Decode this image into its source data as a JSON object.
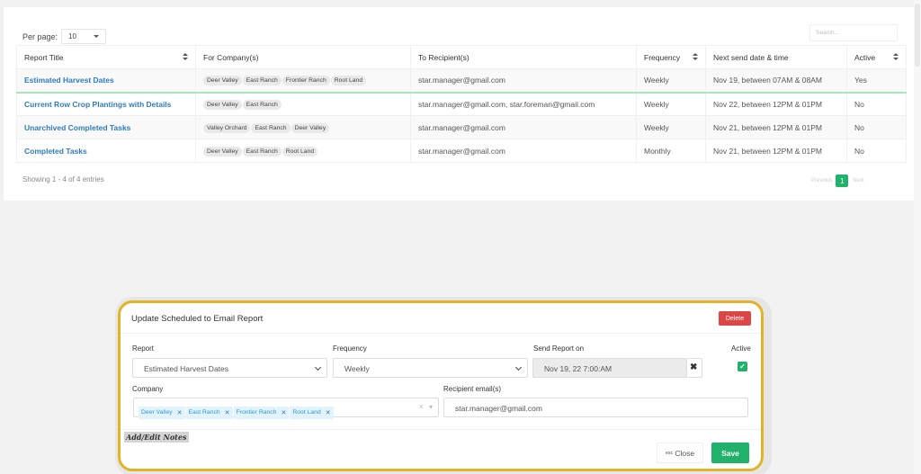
{
  "list": {
    "per_page_label": "Per page:",
    "per_page_value": "10",
    "search_placeholder": "Search...",
    "columns": [
      "Report Title",
      "For Company(s)",
      "To Recipient(s)",
      "Frequency",
      "Next send date & time",
      "Active"
    ],
    "rows": [
      {
        "title": "Estimated Harvest Dates",
        "companies": [
          "Deer Valley",
          "East Ranch",
          "Frontier Ranch",
          "Root Land"
        ],
        "recipients": "star.manager@gmail.com",
        "frequency": "Weekly",
        "next_send": "Nov 19, between 07AM & 08AM",
        "active": "Yes"
      },
      {
        "title": "Current Row Crop Plantings with Details",
        "companies": [
          "Deer Valley",
          "East Ranch"
        ],
        "recipients": "star.manager@gmail.com, star.foreman@gmail.com",
        "frequency": "Weekly",
        "next_send": "Nov 22, between 12PM & 01PM",
        "active": "No"
      },
      {
        "title": "Unarchived Completed Tasks",
        "companies": [
          "Valley Orchard",
          "East Ranch",
          "Deer Valley"
        ],
        "recipients": "star.manager@gmail.com",
        "frequency": "Weekly",
        "next_send": "Nov 21, between 12PM & 01PM",
        "active": "No"
      },
      {
        "title": "Completed Tasks",
        "companies": [
          "Deer Valley",
          "East Ranch",
          "Root Land"
        ],
        "recipients": "star.manager@gmail.com",
        "frequency": "Monthly",
        "next_send": "Nov 21, between 12PM & 01PM",
        "active": "No"
      }
    ],
    "showing": "Showing 1 - 4 of 4 entries",
    "pager": {
      "previous": "Previous",
      "current": "1",
      "next": "Next"
    }
  },
  "modal": {
    "title": "Update Scheduled to Email Report",
    "delete_label": "Delete",
    "report_label": "Report",
    "report_value": "Estimated Harvest Dates",
    "frequency_label": "Frequency",
    "frequency_value": "Weekly",
    "send_on_label": "Send Report on",
    "send_on_value": "Nov 19, 22 7:00:AM",
    "active_label": "Active",
    "active_checked": true,
    "company_label": "Company",
    "companies": [
      "Deer Valley",
      "East Ranch",
      "Frontier Ranch",
      "Root Land"
    ],
    "recipient_label": "Recipient email(s)",
    "recipient_value": "star.manager@gmail.com",
    "notes_label": "Add/Edit Notes",
    "close_esc": "esc",
    "close_label": "Close",
    "save_label": "Save"
  },
  "colors": {
    "accent_green": "#20b16b",
    "link_blue": "#2f7bc0",
    "delete_red": "#dc4646",
    "highlight_border": "#e1b326",
    "tag_blue": "#2c9ad3"
  }
}
